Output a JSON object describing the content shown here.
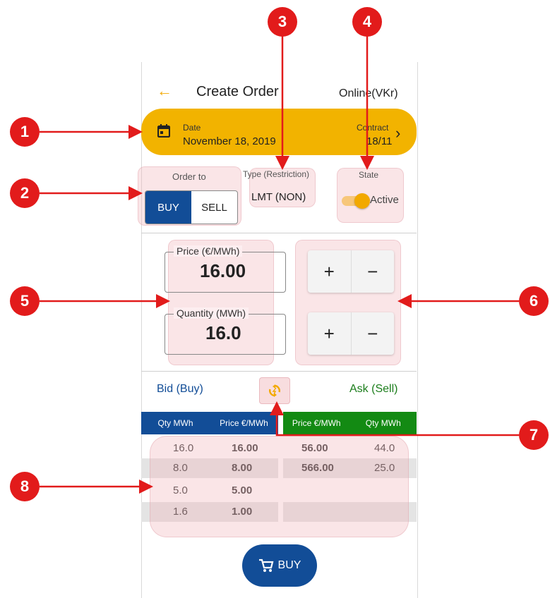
{
  "header": {
    "back_icon": "arrow-left-icon",
    "title": "Create Order",
    "status": "Online(VKr)"
  },
  "datebar": {
    "date_label": "Date",
    "date_value": "November 18, 2019",
    "contract_label": "Contract",
    "contract_value": "18/11",
    "calendar_icon": "calendar-icon",
    "chevron": "›"
  },
  "order_to": {
    "label": "Order to",
    "buy": "BUY",
    "sell": "SELL",
    "selected": "BUY"
  },
  "type": {
    "label": "Type (Restriction)",
    "value": "LMT (NON)"
  },
  "state": {
    "label": "State",
    "value": "Active",
    "on": true
  },
  "price": {
    "label": "Price (€/MWh)",
    "value": "16.00"
  },
  "quantity": {
    "label": "Quantity (MWh)",
    "value": "16.0"
  },
  "steppers": {
    "plus": "+",
    "minus": "−"
  },
  "orderbook": {
    "bid_title": "Bid (Buy)",
    "ask_title": "Ask (Sell)",
    "refresh_icon": "refresh-icon",
    "bid_headers": [
      "Qty MWh",
      "Price €/MWh"
    ],
    "ask_headers": [
      "Price €/MWh",
      "Qty MWh"
    ],
    "rows": [
      {
        "bid_qty": "16.0",
        "bid_price": "16.00",
        "ask_price": "56.00",
        "ask_qty": "44.0"
      },
      {
        "bid_qty": "8.0",
        "bid_price": "8.00",
        "ask_price": "566.00",
        "ask_qty": "25.0"
      },
      {
        "bid_qty": "5.0",
        "bid_price": "5.00",
        "ask_price": "",
        "ask_qty": ""
      },
      {
        "bid_qty": "1.6",
        "bid_price": "1.00",
        "ask_price": "",
        "ask_qty": ""
      }
    ]
  },
  "action": {
    "buy_label": "BUY",
    "cart_icon": "cart-icon"
  },
  "callouts": [
    "1",
    "2",
    "3",
    "4",
    "5",
    "6",
    "7",
    "8"
  ],
  "colors": {
    "accent": "#f2b300",
    "buy": "#124d97",
    "sell": "#138a13",
    "callout": "#e21b1b"
  }
}
